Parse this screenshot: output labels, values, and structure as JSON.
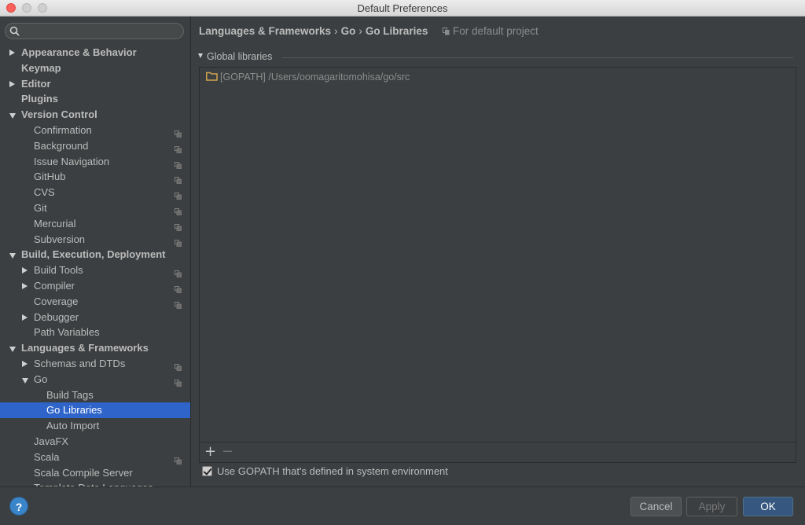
{
  "window": {
    "title": "Default Preferences"
  },
  "search": {
    "placeholder": "",
    "value": ""
  },
  "tree": [
    {
      "label": "Appearance & Behavior",
      "level": 0,
      "bold": true,
      "arrow": "right",
      "proj": false
    },
    {
      "label": "Keymap",
      "level": 0,
      "bold": true,
      "arrow": "none",
      "proj": false
    },
    {
      "label": "Editor",
      "level": 0,
      "bold": true,
      "arrow": "right",
      "proj": false
    },
    {
      "label": "Plugins",
      "level": 0,
      "bold": true,
      "arrow": "none",
      "proj": false
    },
    {
      "label": "Version Control",
      "level": 0,
      "bold": true,
      "arrow": "down",
      "proj": false
    },
    {
      "label": "Confirmation",
      "level": 1,
      "bold": false,
      "arrow": "none",
      "proj": true
    },
    {
      "label": "Background",
      "level": 1,
      "bold": false,
      "arrow": "none",
      "proj": true
    },
    {
      "label": "Issue Navigation",
      "level": 1,
      "bold": false,
      "arrow": "none",
      "proj": true
    },
    {
      "label": "GitHub",
      "level": 1,
      "bold": false,
      "arrow": "none",
      "proj": true
    },
    {
      "label": "CVS",
      "level": 1,
      "bold": false,
      "arrow": "none",
      "proj": true
    },
    {
      "label": "Git",
      "level": 1,
      "bold": false,
      "arrow": "none",
      "proj": true
    },
    {
      "label": "Mercurial",
      "level": 1,
      "bold": false,
      "arrow": "none",
      "proj": true
    },
    {
      "label": "Subversion",
      "level": 1,
      "bold": false,
      "arrow": "none",
      "proj": true
    },
    {
      "label": "Build, Execution, Deployment",
      "level": 0,
      "bold": true,
      "arrow": "down",
      "proj": false
    },
    {
      "label": "Build Tools",
      "level": 1,
      "bold": false,
      "arrow": "right",
      "proj": true
    },
    {
      "label": "Compiler",
      "level": 1,
      "bold": false,
      "arrow": "right",
      "proj": true
    },
    {
      "label": "Coverage",
      "level": 1,
      "bold": false,
      "arrow": "none",
      "proj": true
    },
    {
      "label": "Debugger",
      "level": 1,
      "bold": false,
      "arrow": "right",
      "proj": false
    },
    {
      "label": "Path Variables",
      "level": 1,
      "bold": false,
      "arrow": "none",
      "proj": false
    },
    {
      "label": "Languages & Frameworks",
      "level": 0,
      "bold": true,
      "arrow": "down",
      "proj": false
    },
    {
      "label": "Schemas and DTDs",
      "level": 1,
      "bold": false,
      "arrow": "right",
      "proj": true
    },
    {
      "label": "Go",
      "level": 1,
      "bold": false,
      "arrow": "down",
      "proj": true
    },
    {
      "label": "Build Tags",
      "level": 2,
      "bold": false,
      "arrow": "none",
      "proj": false
    },
    {
      "label": "Go Libraries",
      "level": 2,
      "bold": false,
      "arrow": "none",
      "proj": false,
      "selected": true
    },
    {
      "label": "Auto Import",
      "level": 2,
      "bold": false,
      "arrow": "none",
      "proj": false
    },
    {
      "label": "JavaFX",
      "level": 1,
      "bold": false,
      "arrow": "none",
      "proj": false
    },
    {
      "label": "Scala",
      "level": 1,
      "bold": false,
      "arrow": "none",
      "proj": true
    },
    {
      "label": "Scala Compile Server",
      "level": 1,
      "bold": false,
      "arrow": "none",
      "proj": false
    },
    {
      "label": "Template Data Languages",
      "level": 1,
      "bold": false,
      "arrow": "none",
      "proj": true
    }
  ],
  "main": {
    "breadcrumb": [
      "Languages & Frameworks",
      "Go",
      "Go Libraries"
    ],
    "breadcrumb_sep": "›",
    "for_default": "For default project",
    "section_title": "Global libraries",
    "libraries": [
      {
        "tag": "[GOPATH]",
        "path": "/Users/oomagaritomohisa/go/src"
      }
    ],
    "add_label": "+",
    "remove_label": "−",
    "use_gopath_label": "Use GOPATH that's defined in system environment",
    "use_gopath_checked": true
  },
  "footer": {
    "help_label": "?",
    "cancel_label": "Cancel",
    "apply_label": "Apply",
    "ok_label": "OK"
  },
  "colors": {
    "background": "#3c3f41",
    "selection": "#2f65ca",
    "ok_button": "#365880",
    "help_icon": "#3a84c8"
  }
}
